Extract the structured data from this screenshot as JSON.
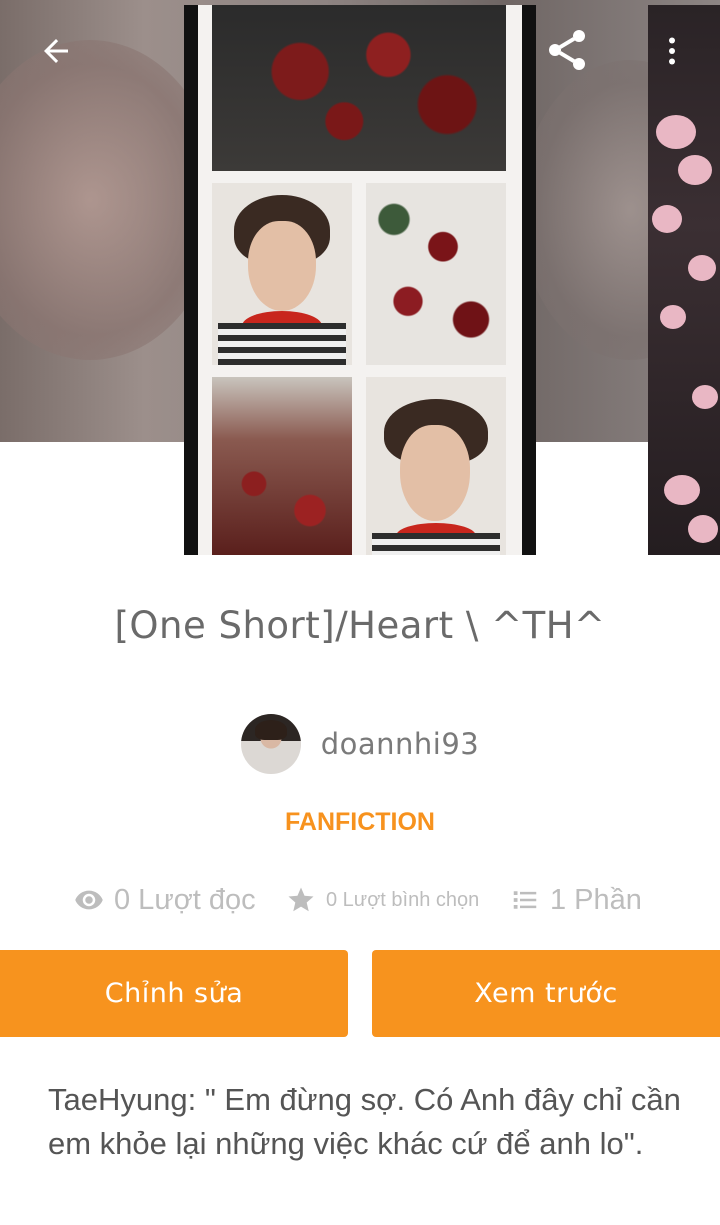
{
  "toolbar": {
    "back_icon": "arrow-left-icon",
    "share_icon": "share-icon",
    "more_icon": "more-vertical-icon"
  },
  "story": {
    "title": "[One Short]/Heart \\ ^TH^",
    "author": "doannhi93",
    "category": "FANFICTION",
    "description": "TaeHyung: \" Em đừng sợ. Có Anh đây chỉ cần em khỏe lại những việc khác cứ để anh lo\"."
  },
  "stats": {
    "reads": "0 Lượt đọc",
    "votes": "0 Lượt bình chọn",
    "parts": "1 Phần"
  },
  "actions": {
    "edit_label": "Chỉnh sửa",
    "preview_label": "Xem trước"
  },
  "colors": {
    "accent": "#f7931e",
    "category": "#f7921e",
    "stat_gray": "#bdbdbd"
  }
}
